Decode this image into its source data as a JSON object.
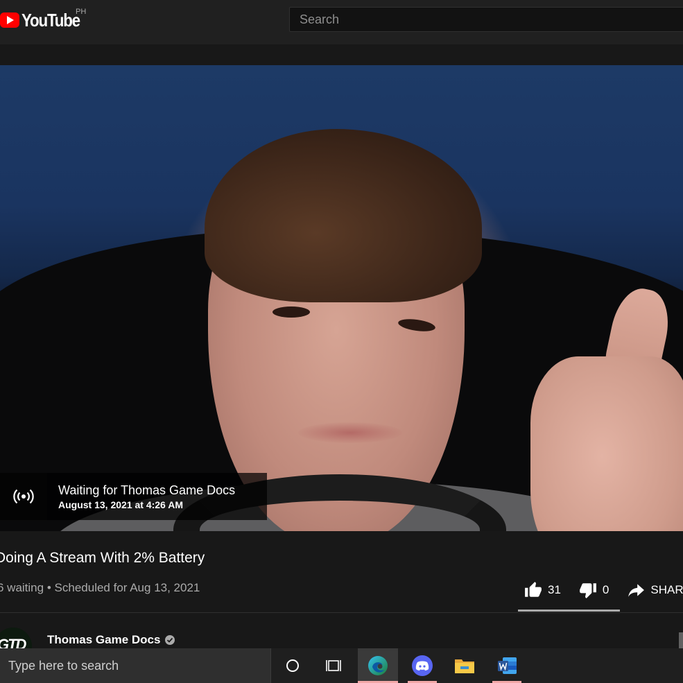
{
  "masthead": {
    "logo_text": "YouTube",
    "country_code": "PH",
    "search_placeholder": "Search"
  },
  "player": {
    "overlay_title": "Waiting for Thomas Game Docs",
    "overlay_date": "August 13, 2021 at 4:26 AM",
    "overlay_icon": "live-broadcast-icon"
  },
  "video": {
    "title": "Doing A Stream With 2% Battery",
    "waiting": "6 waiting",
    "separator": "•",
    "scheduled": "Scheduled for Aug 13, 2021",
    "likes": "31",
    "dislikes": "0",
    "share_label": "SHARE",
    "like_ratio": 1.0
  },
  "channel": {
    "name": "Thomas Game Docs",
    "avatar_text": "GTD",
    "verified": true
  },
  "taskbar": {
    "search_placeholder": "Type here to search",
    "apps": [
      "cortana-icon",
      "task-view-icon",
      "edge-icon",
      "discord-icon",
      "file-explorer-icon",
      "word-icon"
    ]
  },
  "colors": {
    "brand_red": "#ff0000",
    "background": "#181818",
    "masthead": "#202020",
    "discord": "#5865f2",
    "word": "#2b579a"
  }
}
